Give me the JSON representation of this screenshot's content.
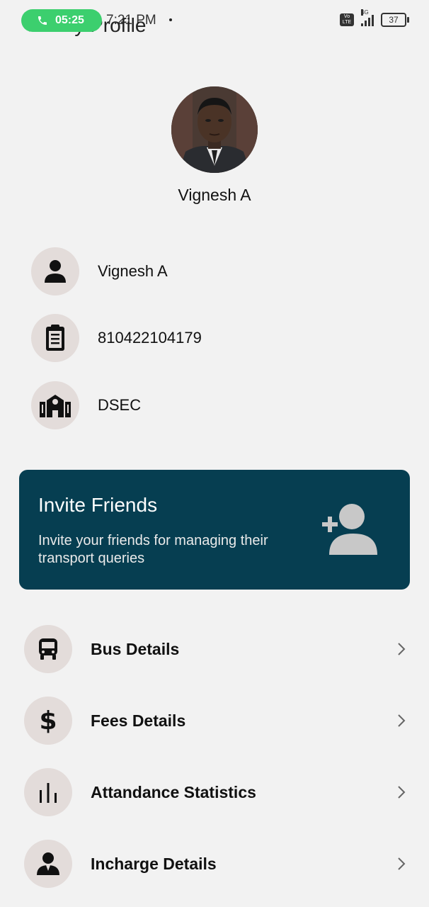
{
  "status_bar": {
    "call_time": "05:25",
    "clock": "7:21 PM",
    "volte": "Vo LTE",
    "network": "4G",
    "battery": "37"
  },
  "header": {
    "title": "My Profile"
  },
  "profile": {
    "name": "Vignesh A",
    "details": [
      {
        "icon": "person-icon",
        "value": "Vignesh A"
      },
      {
        "icon": "clipboard-icon",
        "value": "810422104179"
      },
      {
        "icon": "school-building-icon",
        "value": "DSEC"
      }
    ]
  },
  "invite": {
    "title": "Invite Friends",
    "subtitle": "Invite your friends for managing their transport queries",
    "icon": "add-person-icon"
  },
  "menu": [
    {
      "icon": "bus-icon",
      "label": "Bus Details"
    },
    {
      "icon": "dollar-icon",
      "label": "Fees Details"
    },
    {
      "icon": "bar-chart-icon",
      "label": "Attandance Statistics"
    },
    {
      "icon": "incharge-person-icon",
      "label": "Incharge Details"
    }
  ],
  "colors": {
    "invite_bg": "#063e51",
    "icon_circle": "#e3dcda",
    "call_pill": "#3ccf6e",
    "background": "#f2f2f2"
  }
}
